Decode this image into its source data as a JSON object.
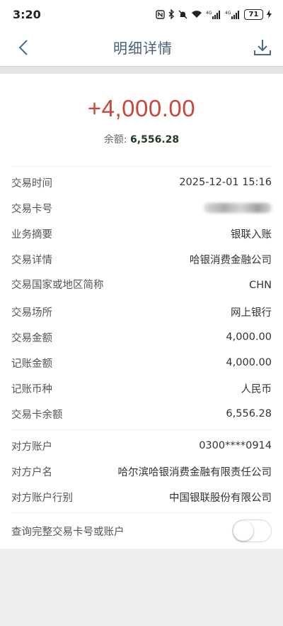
{
  "status_bar": {
    "time": "3:20",
    "network_label": "4G",
    "battery": "71"
  },
  "header": {
    "title": "明细详情",
    "back_icon": "chevron-left-icon",
    "download_icon": "download-icon"
  },
  "summary": {
    "amount": "+4,000.00",
    "balance_label": "余额: ",
    "balance_value": "6,556.28",
    "colors": {
      "amount": "#c8473d",
      "balance": "#1d3a24"
    }
  },
  "details": [
    {
      "label": "交易时间",
      "value": "2025-12-01 15:16"
    },
    {
      "label": "交易卡号",
      "value": ""
    },
    {
      "label": "业务摘要",
      "value": "银联入账"
    },
    {
      "label": "交易详情",
      "value": "哈银消费金融公司"
    },
    {
      "label": "交易国家或地区简称",
      "value": "CHN"
    },
    {
      "label": "交易场所",
      "value": "网上银行"
    },
    {
      "label": "交易金额",
      "value": "4,000.00"
    },
    {
      "label": "记账金额",
      "value": "4,000.00"
    },
    {
      "label": "记账币种",
      "value": "人民币"
    },
    {
      "label": "交易卡余额",
      "value": "6,556.28"
    }
  ],
  "counterparty": [
    {
      "label": "对方账户",
      "value": "0300****0914"
    },
    {
      "label": "对方户名",
      "value": "哈尔滨哈银消费金融有限责任公司"
    },
    {
      "label": "对方账户行别",
      "value": "中国银联股份有限公司"
    }
  ],
  "toggle": {
    "label": "查询完整交易卡号或账户",
    "state": "off"
  }
}
